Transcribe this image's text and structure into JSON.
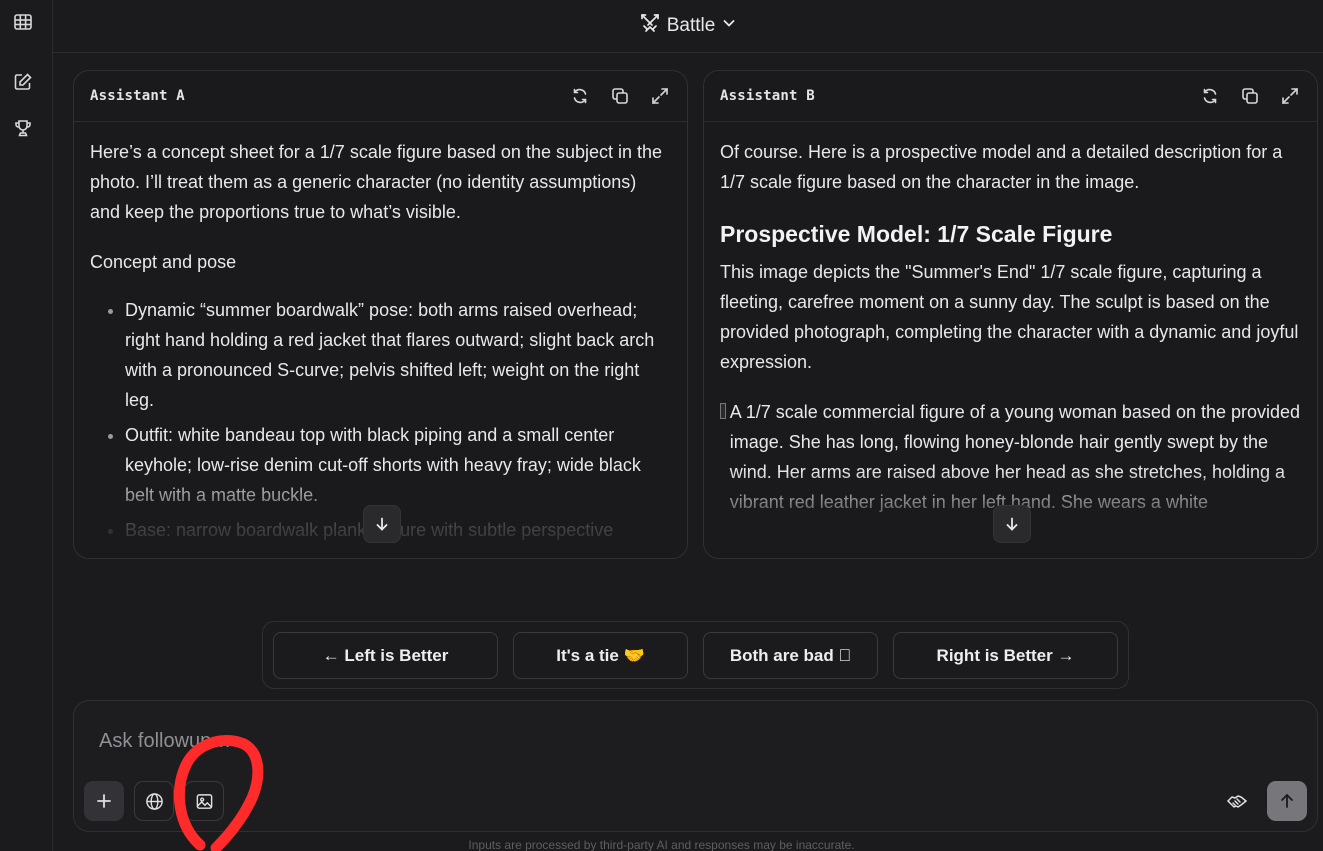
{
  "sidebar": {
    "items": [
      {
        "icon": "grid-icon"
      },
      {
        "icon": "edit-icon"
      },
      {
        "icon": "trophy-icon"
      }
    ]
  },
  "header": {
    "mode_label": "Battle",
    "mode_icon": "crossed-swords-icon"
  },
  "panels": {
    "a": {
      "name": "Assistant A",
      "intro": "Here’s a concept sheet for a 1/7 scale figure based on the subject in the photo. I’ll treat them as a generic character (no identity assumptions) and keep the proportions true to what’s visible.",
      "section": "Concept and pose",
      "bullets": [
        "Dynamic “summer boardwalk” pose: both arms raised overhead; right hand holding a red jacket that flares outward; slight back arch with a pronounced S-curve; pelvis shifted left; weight on the right leg.",
        "Outfit: white bandeau top with black piping and a small center keyhole; low-rise denim cut-off shorts with heavy fray; wide black belt with a matte buckle.",
        "Base: narrow boardwalk plank texture with subtle perspective"
      ]
    },
    "b": {
      "name": "Assistant B",
      "intro": "Of course. Here is a prospective model and a detailed description for a 1/7 scale figure based on the character in the image.",
      "heading": "Prospective Model: 1/7 Scale Figure",
      "description": "This image depicts the \"Summer's End\" 1/7 scale figure, capturing a fleeting, carefree moment on a sunny day. The sculpt is based on the provided photograph, completing the character with a dynamic and joyful expression.",
      "image_alt": "A 1/7 scale commercial figure of a young woman based on the provided image. She has long, flowing honey-blonde hair gently swept by the wind. Her arms are raised above her head as she stretches, holding a vibrant red leather jacket in her left hand. She wears a white"
    }
  },
  "votes": {
    "left": "← Left is Better",
    "tie": "It's a tie 🤝",
    "bad": "Both are bad ⃠",
    "right": "Right is Better →"
  },
  "composer": {
    "placeholder": "Ask followup…",
    "value": ""
  },
  "disclaimer": "Inputs are processed by third-party AI and responses may be inaccurate.",
  "colors": {
    "background": "#1b1b1d",
    "panel_border": "#303033",
    "annotation": "#ff2a2a"
  }
}
